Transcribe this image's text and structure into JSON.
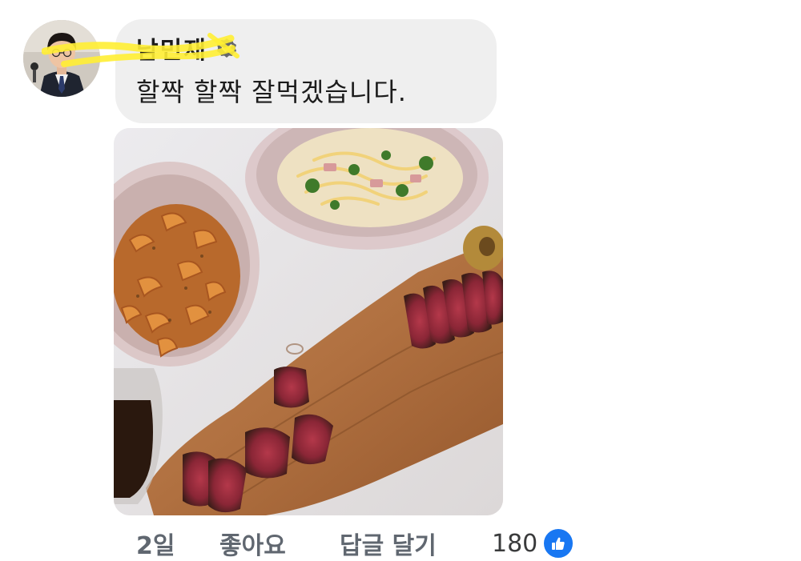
{
  "comment": {
    "author": "남민재",
    "verified_icon": "verified-badge-icon",
    "text": "할짝 할짝 잘먹겠습니다.",
    "photo_icon": "food-photo",
    "avatar_icon": "user-avatar"
  },
  "actions": {
    "time": "2일",
    "like_label": "좋아요",
    "reply_label": "답글 달기",
    "reaction_count": "180",
    "reaction_icon": "thumbs-up-icon"
  },
  "colors": {
    "bubble": "#efefef",
    "like_blue": "#1877f2",
    "action_gray": "#606770",
    "redaction_highlight": "#ffee33"
  }
}
